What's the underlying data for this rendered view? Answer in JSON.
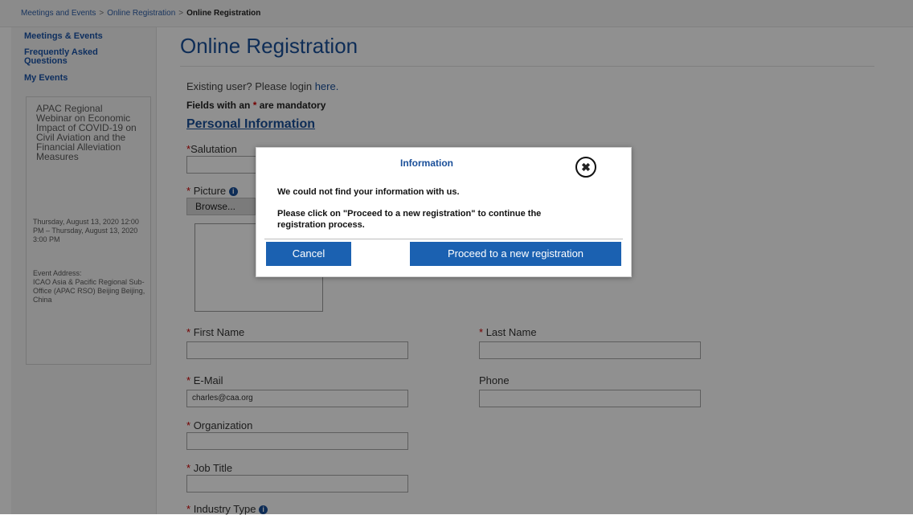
{
  "breadcrumb": {
    "items": [
      "Meetings and Events",
      "Online Registration",
      "Online Registration"
    ],
    "separator": ">"
  },
  "sidebar": {
    "links": [
      "Meetings & Events",
      "Frequently Asked Questions",
      "My Events"
    ],
    "event": {
      "title": "APAC Regional Webinar on Economic Impact of COVID-19 on Civil Aviation and the Financial Alleviation Measures",
      "date": "Thursday, August 13, 2020 12:00 PM – Thursday, August 13, 2020 3:00 PM",
      "address_label": "Event Address:",
      "address": "ICAO Asia & Pacific Regional Sub-Office (APAC RSO) Beijing Beijing, China"
    }
  },
  "main": {
    "title": "Online Registration",
    "login_prefix": "Existing user? Please login ",
    "login_link": "here.",
    "mandatory_prefix": "Fields with an ",
    "mandatory_star": "*",
    "mandatory_suffix": " are mandatory",
    "section_title": "Personal Information",
    "salutation_label": "Salutation",
    "picture_label": "Picture",
    "browse_label": "Browse...",
    "first_name_label": "First Name",
    "last_name_label": "Last Name",
    "email_label": "E-Mail",
    "email_value": "charles@caa.org",
    "phone_label": "Phone",
    "organization_label": "Organization",
    "job_title_label": "Job Title",
    "industry_type_label": "Industry Type",
    "info_icon_text": "i"
  },
  "modal": {
    "title": "Information",
    "close_icon": "✖",
    "message1": "We could not find your information with us.",
    "message2": "Please click on \"Proceed to a new registration\" to continue the registration process.",
    "cancel_label": "Cancel",
    "proceed_label": "Proceed to a new registration"
  },
  "colors": {
    "accent": "#1b61b1",
    "title": "#1a4f99",
    "overlay": "rgba(0,0,0,0.43)"
  }
}
